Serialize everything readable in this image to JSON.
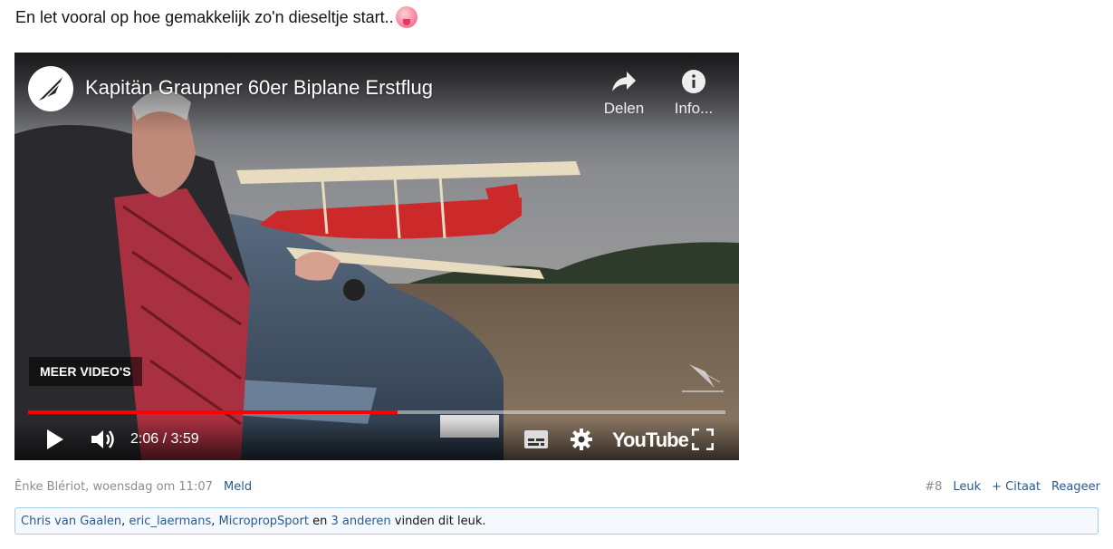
{
  "post": {
    "text": "En let vooral op hoe gemakkelijk zo'n dieseltje start..",
    "emoji": "tongue-face-emoji"
  },
  "video": {
    "title": "Kapitän Graupner 60er Biplane Erstflug",
    "share_label": "Delen",
    "info_label": "Info...",
    "more_videos_label": "MEER VIDEO'S",
    "current_time": "2:06",
    "duration": "3:59",
    "time_display": "2:06 / 3:59",
    "progress": 0.53,
    "logo_text": "YouTube",
    "colors": {
      "progress": "#ff0000",
      "overlay": "#000000"
    }
  },
  "meta": {
    "author_date": "Ênke Blériot, woensdag om 11:07",
    "report_label": "Meld",
    "post_number": "#8",
    "like_label": "Leuk",
    "quote_label": "+ Citaat",
    "reply_label": "Reageer"
  },
  "likes": {
    "user1": "Chris van Gaalen",
    "sep1": ", ",
    "user2": "eric_laermans",
    "sep2": ", ",
    "user3": "MicropropSport",
    "mid": " en ",
    "others": "3 anderen",
    "tail": " vinden dit leuk."
  },
  "colors": {
    "link": "#2b5a8e",
    "likes_border": "#a7cde6"
  }
}
